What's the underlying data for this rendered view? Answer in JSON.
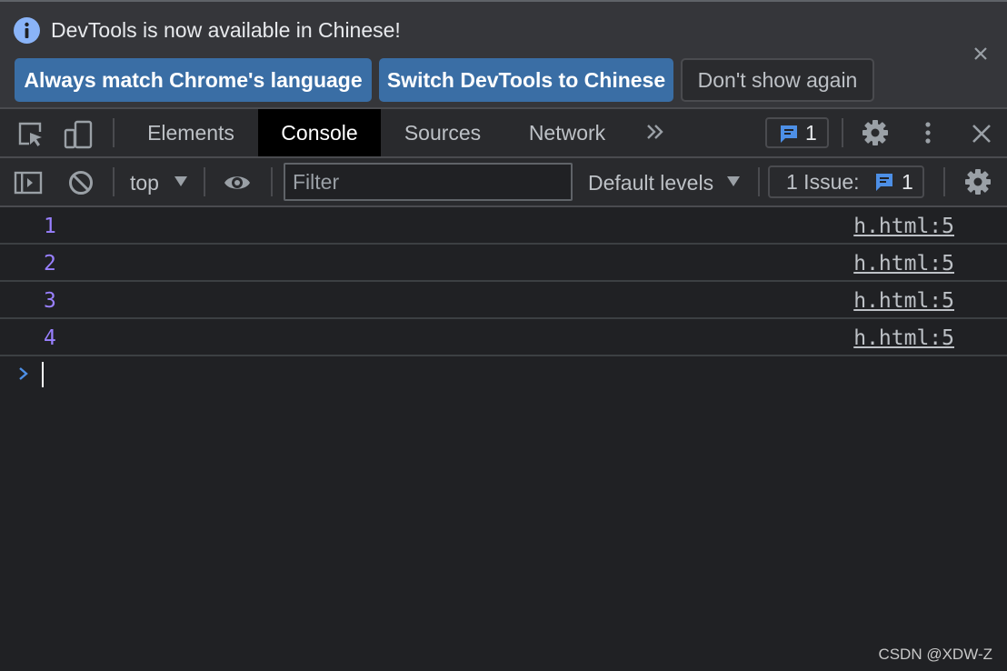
{
  "infobar": {
    "message": "DevTools is now available in Chinese!",
    "buttons": {
      "match_language": "Always match Chrome's language",
      "switch_chinese": "Switch DevTools to Chinese",
      "dont_show": "Don't show again"
    }
  },
  "tabs": {
    "elements": "Elements",
    "console": "Console",
    "sources": "Sources",
    "network": "Network",
    "active": "Console",
    "messages_count": "1"
  },
  "console_toolbar": {
    "context": "top",
    "filter_placeholder": "Filter",
    "levels": "Default levels",
    "issues_label": "1 Issue:",
    "issues_count": "1"
  },
  "console_rows": [
    {
      "value": "1",
      "source": "h.html:5"
    },
    {
      "value": "2",
      "source": "h.html:5"
    },
    {
      "value": "3",
      "source": "h.html:5"
    },
    {
      "value": "4",
      "source": "h.html:5"
    }
  ],
  "colors": {
    "accent": "#8ab4f8",
    "primary_button": "#3a6ea5",
    "active_tab": "#000000",
    "number_value": "#9980ff",
    "background": "#202124"
  },
  "icons": [
    "info-icon",
    "close-icon",
    "inspect-icon",
    "device-toggle-icon",
    "more-tabs-icon",
    "message-icon",
    "gear-icon",
    "kebab-menu-icon",
    "sidebar-toggle-icon",
    "clear-console-icon",
    "eye-icon",
    "dropdown-arrow-icon",
    "prompt-chevron-icon"
  ],
  "watermark": "CSDN @XDW-Z"
}
